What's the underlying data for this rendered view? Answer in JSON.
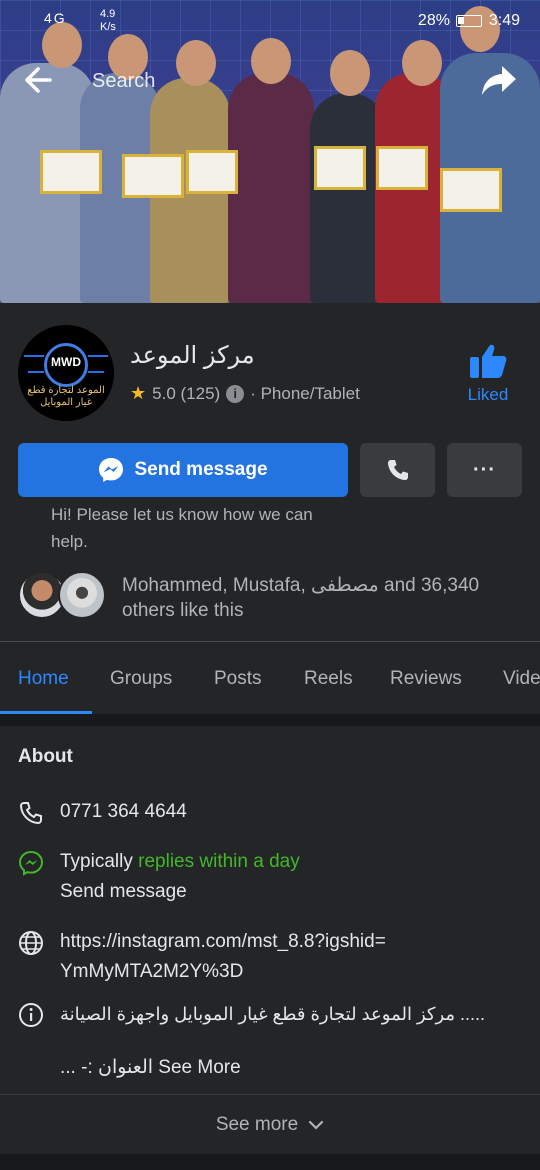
{
  "statusbar": {
    "signal": "4G",
    "speed": "4.9\nK/s",
    "battery": "28%",
    "time": "3:49"
  },
  "cover": {
    "search_placeholder": "Search"
  },
  "page": {
    "name": "مركز الموعد",
    "rating": "5.0 (125)",
    "category": "· Phone/Tablet",
    "liked_label": "Liked",
    "avatar_logo": "MWD",
    "avatar_subtitle": "الموعد لتجارة قطع غيار الموبايل"
  },
  "actions": {
    "send_message": "Send message",
    "more": "···"
  },
  "greeting": "Hi! Please let us know how we can help.",
  "likes": {
    "text": "Mohammed, Mustafa, مصطفى and 36,340 others like this"
  },
  "tabs": [
    {
      "label": "Home"
    },
    {
      "label": "Groups"
    },
    {
      "label": "Posts"
    },
    {
      "label": "Reels"
    },
    {
      "label": "Reviews"
    },
    {
      "label": "Vide"
    }
  ],
  "about": {
    "title": "About",
    "phone": "0771 364 4644",
    "response_prefix": "Typically",
    "response_time": "replies within a day",
    "send_message": "Send message",
    "website_line1": "https://instagram.com/mst_8.8?igshid=",
    "website_line2": "YmMyMTA2M2Y%3D",
    "description_line1": "..... مركز الموعد لتجارة قطع غيار الموبايل واجهزة الصيانة",
    "description_line2": "العنوان :- ...",
    "see_more_inline": "See More"
  },
  "footer": {
    "see_more": "See more"
  },
  "colors": {
    "accent": "#2d88ff",
    "button_blue": "#2374e1",
    "green": "#42b72a",
    "surface": "#242526",
    "background": "#18191a"
  }
}
